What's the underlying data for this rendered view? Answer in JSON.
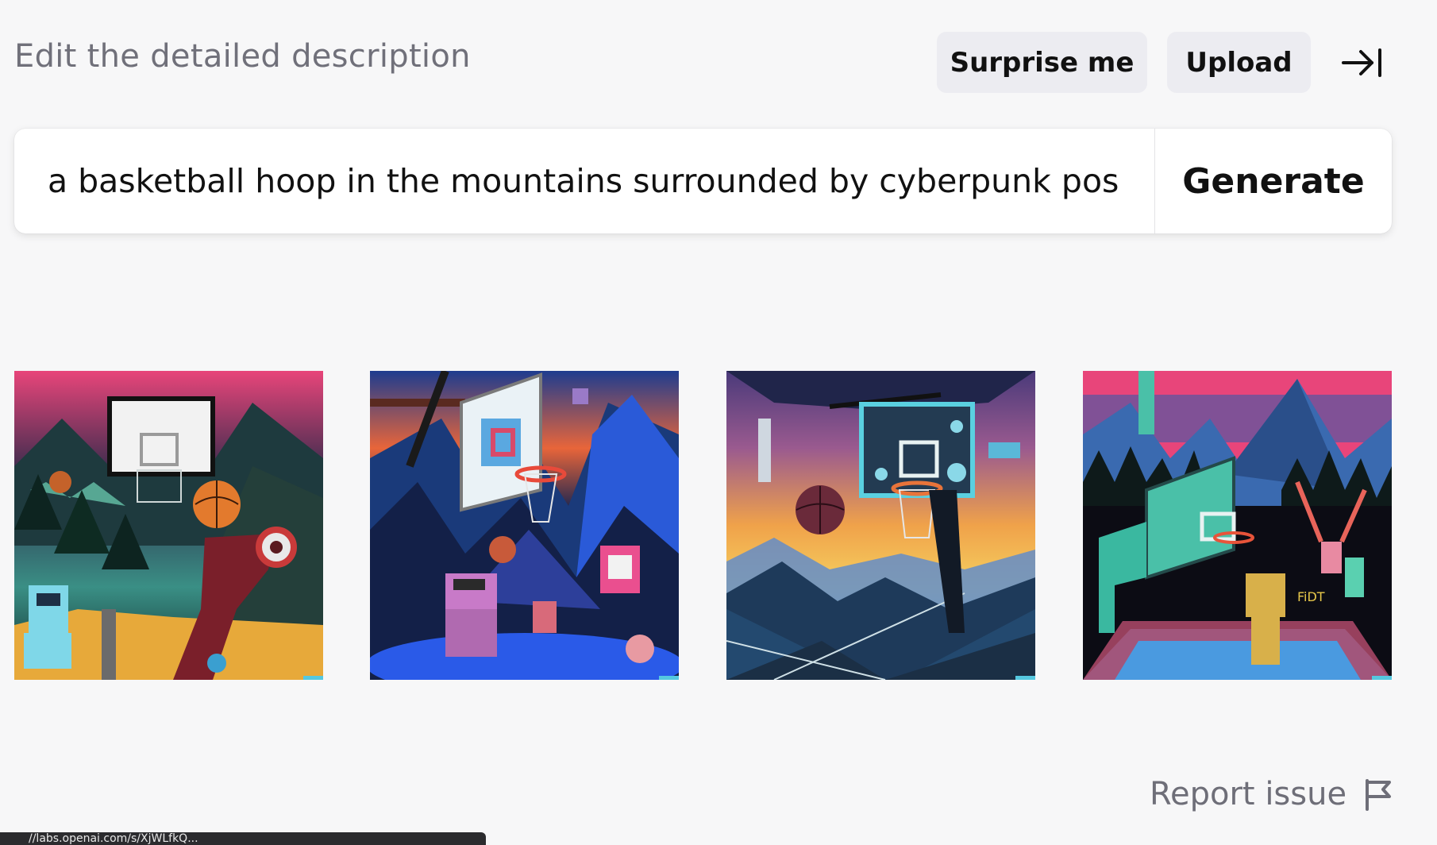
{
  "header": {
    "title": "Edit the detailed description",
    "surprise_label": "Surprise me",
    "upload_label": "Upload",
    "collapse_icon": "arrow-right-to-bar-icon"
  },
  "prompt": {
    "value": "a basketball hoop in the mountains surrounded by cyberpunk pos",
    "generate_label": "Generate"
  },
  "gallery": {
    "images": [
      {
        "palette": "pink-sky-forest"
      },
      {
        "palette": "sunset-blue-mountains"
      },
      {
        "palette": "purple-yellow-dusk"
      },
      {
        "palette": "pink-sky-teal-court"
      }
    ],
    "text_in_image_4": "FiDT"
  },
  "footer": {
    "report_label": "Report issue",
    "report_icon": "flag-icon"
  },
  "status_url": "//labs.openai.com/s/XjWLfkQ..."
}
